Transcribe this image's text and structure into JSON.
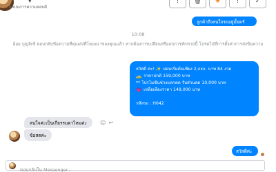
{
  "header": {
    "subtitle": "ผลบนการความลอบดี",
    "chevron": "▾",
    "actions": [
      {
        "name": "info-icon",
        "glyph": "!"
      },
      {
        "name": "trash-icon",
        "glyph": "🗑"
      },
      {
        "name": "star-icon",
        "glyph": "★"
      },
      {
        "name": "flag-icon",
        "glyph": "!"
      },
      {
        "name": "check-icon",
        "glyph": "✓"
      }
    ]
  },
  "messages": {
    "outgoing_top": "ลูกค้าถึงสนใจรถอยู่มั้ยครั",
    "timestamp": "10:08",
    "system_note": "อ้อย บุญจิเซ้ ตอบกลับข้อความที่คุณส่งที่โฆษณาของคุณแล้ว หากต้องการเปลี่ยนหรือลบการทักทายนี้ โปรดไปที่การตั้งค่าการส่งข้อความ",
    "offer": {
      "line1_emoji": "สวัสดี ค่ะ! ✨",
      "line1_text": "ผ่อนเริ่มต้นเพียง 2,xxx. บาท 84 งวด",
      "line2_emoji": "🚕",
      "line2_text": "ราคาปกติ 159,000 บาท",
      "line3_text": "** โปรโมชั่นช่วงแลกตด รับส่วนลด 10,000 บาท",
      "line4_emoji": "💗",
      "line4_text": "เหลือเพียงราคา 149,000 บาท",
      "code": "รหัสรถ : H042"
    },
    "incoming_1": "สนใจค่ะเป็นเกียรรมดาไหมค่ะ",
    "incoming_2": "ข้อสดค่ะ",
    "outgoing_bottom": "สวัสดีค่ะ"
  },
  "composer": {
    "placeholder": "ตอบกลับใน Messenger..."
  },
  "colors": {
    "outgoing_bubble": "#0084ff",
    "incoming_bubble": "#e4e6eb",
    "star_accent": "#f08a24"
  }
}
